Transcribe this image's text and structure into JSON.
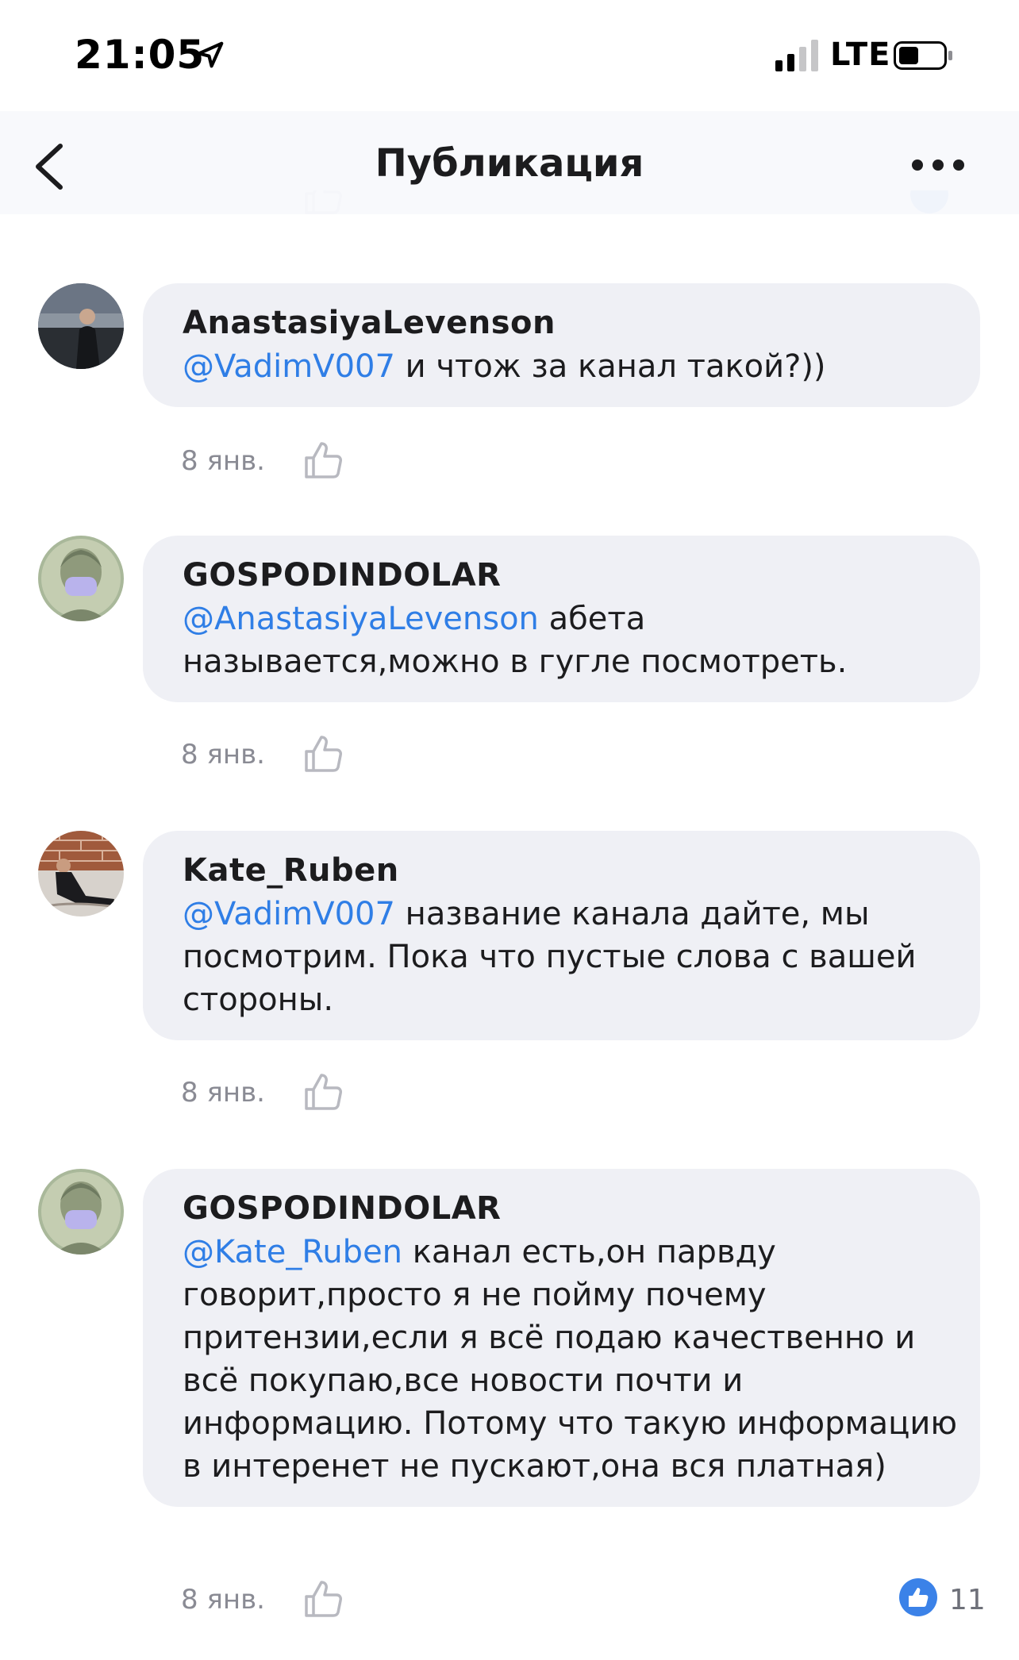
{
  "status_bar": {
    "time": "21:05",
    "network": "LTE",
    "icons": [
      "location-arrow-icon",
      "signal-icon",
      "battery-icon"
    ]
  },
  "nav": {
    "title": "Публикация",
    "back_icon": "chevron-left-icon",
    "more_icon": "more-dots-icon"
  },
  "colors": {
    "mention": "#2f7ee6",
    "bubble": "#eff0f5",
    "meta_text": "#8a8b94",
    "like_badge": "#3b82e8"
  },
  "comments": [
    {
      "author": "AnastasiyaLevenson",
      "mention": "@VadimV007",
      "text": " и чтож за канал такой?))",
      "date": "8 янв.",
      "likes": ""
    },
    {
      "author": "GOSPODINDOLAR",
      "mention": "@AnastasiyaLevenson",
      "text": " абета называется,можно в гугле посмотреть.",
      "date": "8 янв.",
      "likes": ""
    },
    {
      "author": "Kate_Ruben",
      "mention": "@VadimV007",
      "text": " название канала дайте, мы посмотрим. Пока что пустые слова с вашей стороны.",
      "date": "8 янв.",
      "likes": ""
    },
    {
      "author": "GOSPODINDOLAR",
      "mention": "@Kate_Ruben",
      "text": " канал есть,он парвду говорит,просто я не пойму почему притензии,если я всё подаю качественно и всё покупаю,все новости почти и информацию. Потому что такую информацию в интеренет не пускают,она вся платная)",
      "date": "8 янв.",
      "likes": "11"
    }
  ]
}
